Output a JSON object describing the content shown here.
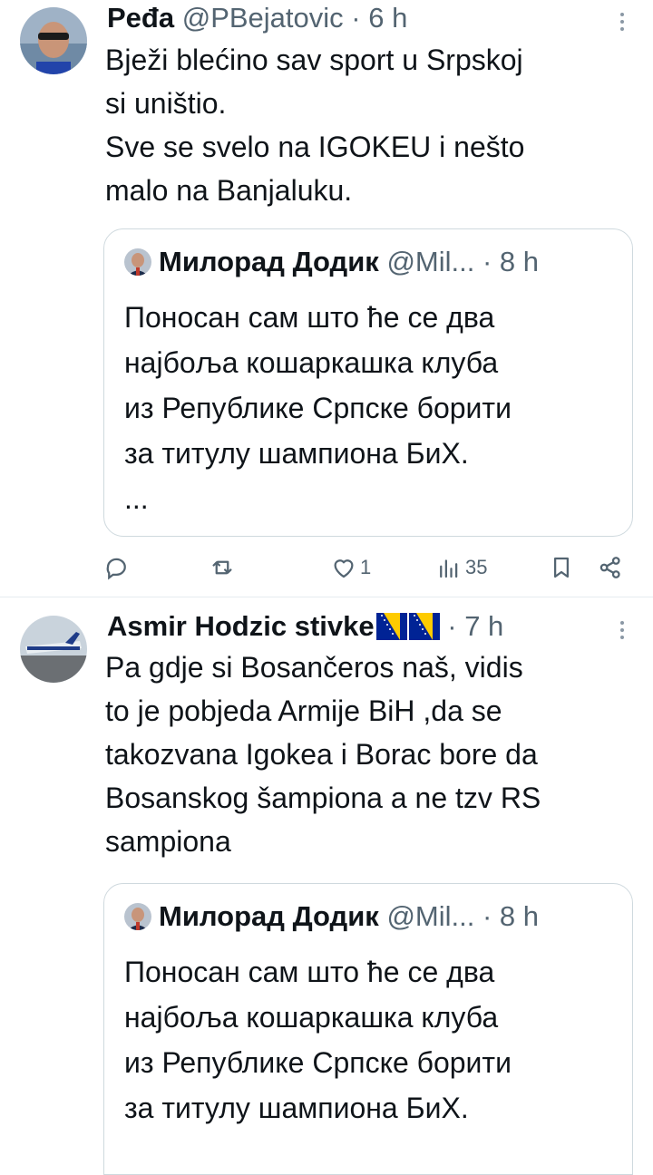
{
  "tweets": [
    {
      "author_name": "Peđa",
      "handle": "@PBejatovic",
      "separator": "·",
      "time": "6 h",
      "body_lines": [
        "Bježi blećino sav sport u Srpskoj",
        "si uništio.",
        "Sve se svelo na IGOKEU i nešto",
        "malo na Banjaluku."
      ],
      "quote": {
        "author_name": "Милорад Додик",
        "handle": "@Mil...",
        "separator": "·",
        "time": "8 h",
        "body_lines": [
          "Поносан сам што ће се два",
          "најбоља кошаркашка клуба",
          "из Републике Српске борити",
          "за титулу шампиона БиХ.",
          "..."
        ]
      },
      "actions": {
        "reply_count": "",
        "retweet_count": "",
        "like_count": "1",
        "views_count": "35"
      }
    },
    {
      "author_name": "Asmir Hodzic stivke",
      "handle": "",
      "separator": "·",
      "time": "7 h",
      "body_lines": [
        "Pa gdje si Bosančeros naš, vidis",
        "to je pobjeda Armije BiH ,da se",
        "takozvana Igokea i Borac bore da",
        "Bosanskog šampiona a ne tzv RS",
        "sampiona"
      ],
      "quote": {
        "author_name": "Милорад Додик",
        "handle": "@Mil...",
        "separator": "·",
        "time": "8 h",
        "body_lines": [
          "Поносан сам што ће се два",
          "најбоља кошаркашка клуба",
          "из Републике Српске борити",
          "за титулу шампиона БиХ."
        ]
      }
    }
  ],
  "colors": {
    "text_primary": "#0f1419",
    "text_secondary": "#536471",
    "border": "#cfd9de",
    "flag_blue": "#002395",
    "flag_yellow": "#fecb00"
  }
}
